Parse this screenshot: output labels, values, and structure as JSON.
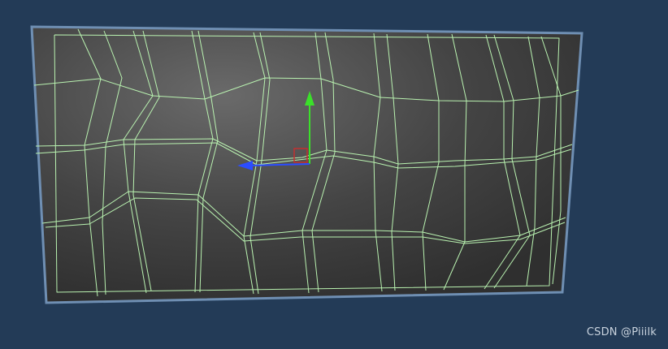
{
  "scene": {
    "background_color": "#233b57",
    "panel_border_color": "#6f8fb3",
    "panel_fill_light": "#6c6c6c",
    "panel_fill_dark": "#2e2e2e",
    "wire_color": "#b9f2b0",
    "gizmo": {
      "y_axis_color": "#3be02a",
      "x_axis_color": "#2b4dff",
      "handle_color": "#c23030"
    }
  },
  "watermark": {
    "text": "CSDN @Piiilk"
  }
}
